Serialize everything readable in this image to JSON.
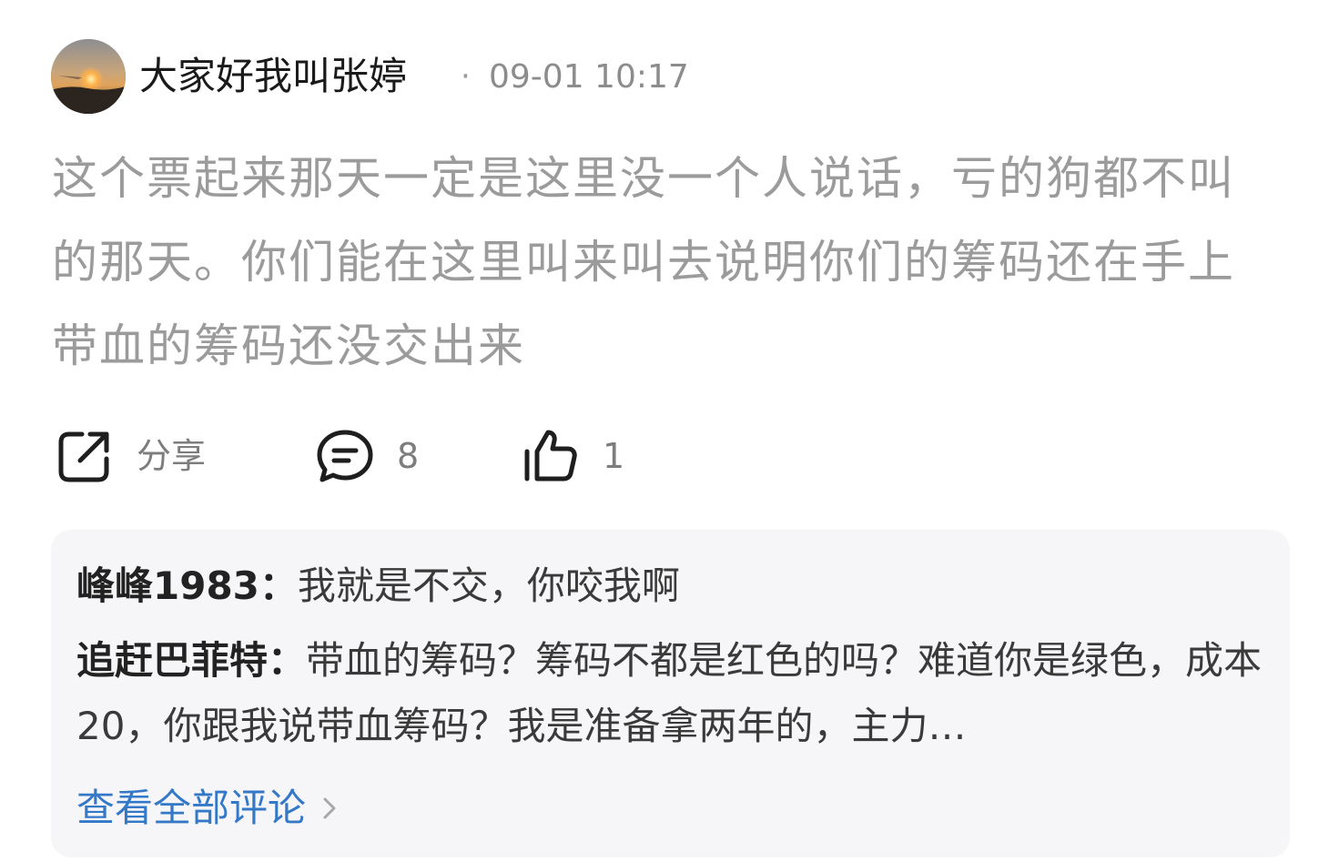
{
  "post": {
    "author": "大家好我叫张婷",
    "separator": "·",
    "timestamp": "09-01 10:17",
    "content": "这个票起来那天一定是这里没一个人说话，亏的狗都不叫的那天。你们能在这里叫来叫去说明你们的筹码还在手上带血的筹码还没交出来"
  },
  "actions": {
    "share_label": "分享",
    "comment_count": "8",
    "like_count": "1"
  },
  "comments": [
    {
      "user": "峰峰1983：",
      "text": "我就是不交，你咬我啊"
    },
    {
      "user": "追赶巴菲特：",
      "text": "带血的筹码？筹码不都是红色的吗？难道你是绿色，成本20，你跟我说带血筹码？我是准备拿两年的，主力…"
    }
  ],
  "view_all_label": "查看全部评论",
  "icons": {
    "share": "share-icon",
    "comment": "comment-icon",
    "like": "thumbs-up-icon",
    "chevron": "chevron-right-icon"
  },
  "colors": {
    "content_text": "#9b9b9b",
    "link": "#3478c8",
    "comment_bg": "#f6f6f8"
  }
}
